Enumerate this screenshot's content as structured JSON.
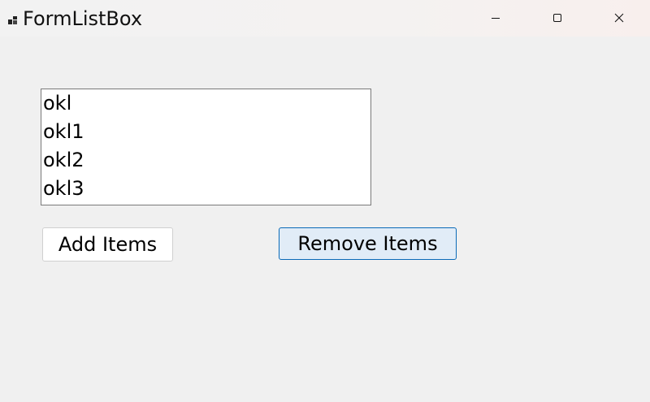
{
  "window": {
    "title": "FormListBox",
    "app_icon": "app-icon",
    "caption_buttons": {
      "minimize_icon": "minimize-icon",
      "maximize_icon": "maximize-icon",
      "close_icon": "close-icon"
    }
  },
  "listbox": {
    "items": [
      "okl",
      "okl1",
      "okl2",
      "okl3"
    ]
  },
  "buttons": {
    "add_label": "Add Items",
    "remove_label": "Remove Items"
  },
  "colors": {
    "background": "#f0f0f0",
    "focused_button_bg": "#e1ecf7",
    "focused_button_border": "#0a6ab8"
  }
}
